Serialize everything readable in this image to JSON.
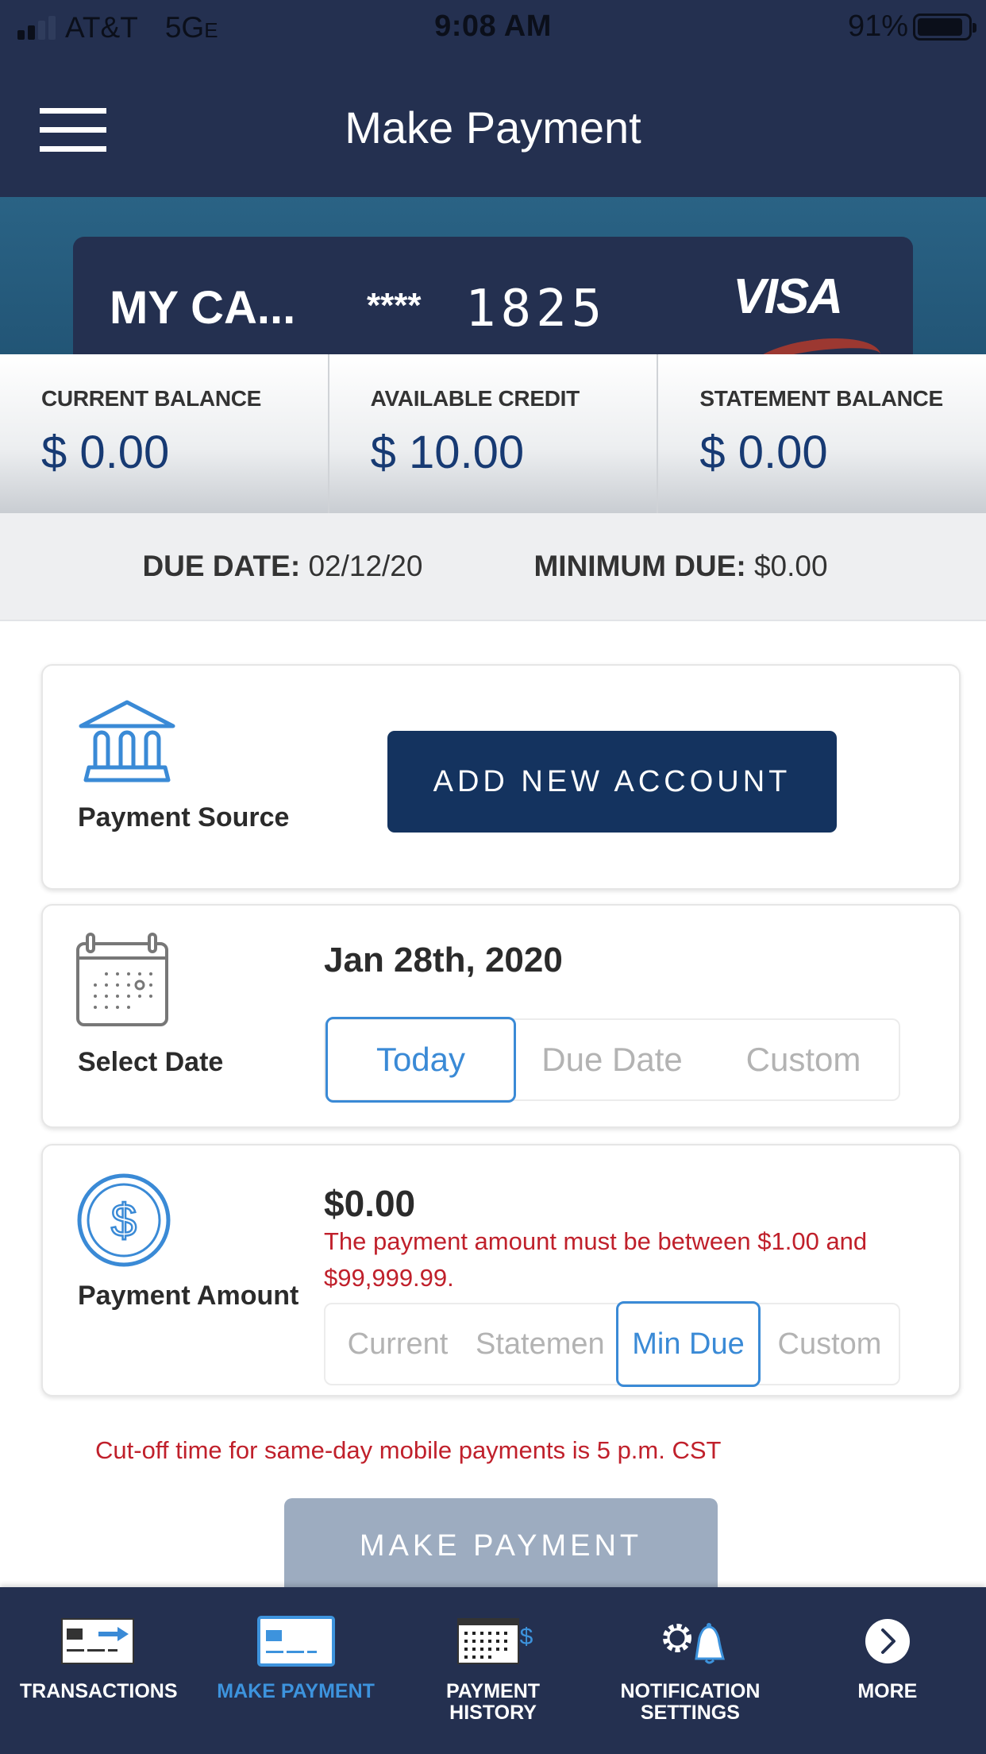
{
  "status_bar": {
    "carrier": "AT&T",
    "network": "5G",
    "network_suffix": "E",
    "time": "9:08 AM",
    "battery": "91%",
    "battery_level": 0.91,
    "signal_bars": 2
  },
  "header": {
    "title": "Make Payment",
    "menu_icon": "hamburger-menu-icon"
  },
  "card": {
    "name": "MY CA...",
    "mask": "****",
    "last4": "1825",
    "brand": "VISA"
  },
  "balances": [
    {
      "label": "CURRENT BALANCE",
      "value": "$ 0.00"
    },
    {
      "label": "AVAILABLE CREDIT",
      "value": "$ 10.00"
    },
    {
      "label": "STATEMENT BALANCE",
      "value": "$ 0.00"
    }
  ],
  "due": {
    "due_date_label": "DUE DATE:",
    "due_date_value": "02/12/20",
    "min_due_label": "MINIMUM DUE:",
    "min_due_value": "$0.00"
  },
  "payment_source": {
    "icon": "bank-icon",
    "label": "Payment Source",
    "button": "ADD NEW ACCOUNT"
  },
  "select_date": {
    "icon": "calendar-icon",
    "label": "Select Date",
    "value": "Jan 28th, 2020",
    "options": [
      "Today",
      "Due Date",
      "Custom"
    ],
    "selected": "Today"
  },
  "payment_amount": {
    "icon": "dollar-circle-icon",
    "label": "Payment Amount",
    "value": "$0.00",
    "error": "The payment amount must be between $1.00 and $99,999.99.",
    "options": [
      "Current",
      "Statemen",
      "Min Due",
      "Custom"
    ],
    "selected": "Min Due"
  },
  "cutoff_notice": "Cut-off time for same-day mobile payments is 5 p.m. CST",
  "make_payment_button": "MAKE PAYMENT",
  "colors": {
    "navy": "#243050",
    "primary_button": "#14335f",
    "accent_blue": "#3a8ad6",
    "error_red": "#c0202b",
    "disabled_button": "#9dacc0"
  },
  "tabbar": {
    "items": [
      {
        "label": "TRANSACTIONS",
        "icon": "transactions-icon",
        "active": false
      },
      {
        "label": "MAKE PAYMENT",
        "icon": "make-payment-icon",
        "active": true
      },
      {
        "label": "PAYMENT\nHISTORY",
        "icon": "payment-history-icon",
        "active": false
      },
      {
        "label": "NOTIFICATION\nSETTINGS",
        "icon": "notification-settings-icon",
        "active": false
      },
      {
        "label": "MORE",
        "icon": "more-chevron-icon",
        "active": false
      }
    ]
  }
}
